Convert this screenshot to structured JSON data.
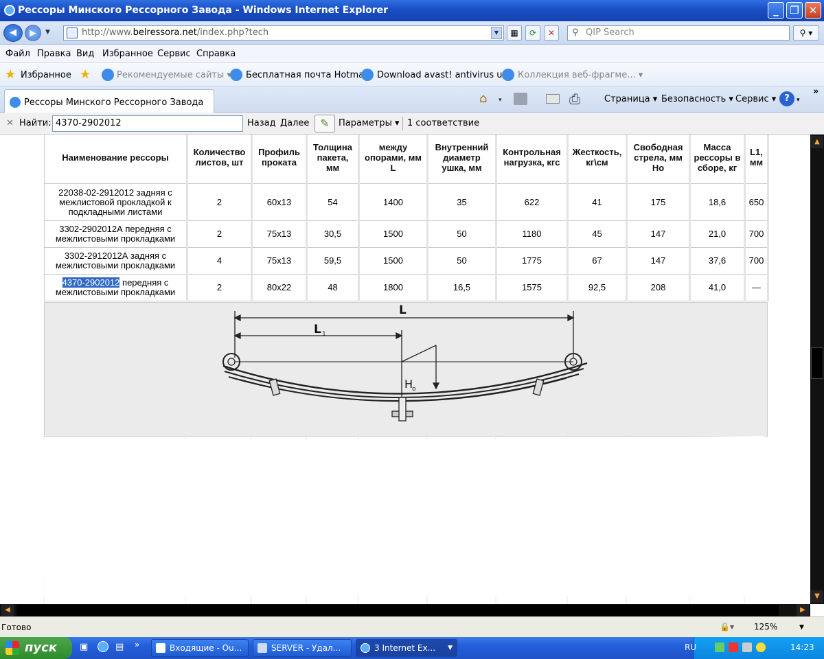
{
  "window": {
    "title": "Рессоры Минского Рессорного Завода - Windows Internet Explorer",
    "min_icon": "minimize-icon",
    "max_icon": "maximize-icon",
    "close_icon": "close-icon"
  },
  "address": {
    "url_prefix": "http://www.",
    "url_domain": "belressora.net",
    "url_suffix": "/index.php?tech",
    "search_placeholder": "QIP Search"
  },
  "menu": [
    "Файл",
    "Правка",
    "Вид",
    "Избранное",
    "Сервис",
    "Справка"
  ],
  "favorites": {
    "label": "Избранное",
    "items": [
      "Рекомендуемые сайты ▾",
      "Бесплатная почта Hotmail",
      "Download avast! antivirus u...",
      "Коллекция веб-фрагме... ▾"
    ]
  },
  "tabs": {
    "active": "Рессоры Минского Рессорного Завода",
    "tools": [
      "Страница ▾",
      "Безопасность ▾",
      "Сервис ▾"
    ]
  },
  "find": {
    "close": "✕",
    "label": "Найти:",
    "value": "4370-2902012",
    "back": "Назад",
    "next": "Далее",
    "options": "Параметры ▾",
    "result": "1 соответствие"
  },
  "table": {
    "headers": [
      "Наименование рессоры",
      "Количество листов, шт",
      "Профиль проката",
      "Толщина пакета, мм",
      "между опорами, мм L",
      "Внутренний диаметр ушка, мм",
      "Контрольная нагрузка, кгс",
      "Жесткость, кг\\см",
      "Свободная стрела, мм Но",
      "Масса рессоры в сборе, кг",
      "L1, мм"
    ],
    "rows": [
      [
        "22038-02-2912012 задняя с межлистовой прокладкой к подкладными листами",
        "2",
        "60x13",
        "54",
        "1400",
        "35",
        "622",
        "41",
        "175",
        "18,6",
        "650"
      ],
      [
        "3302-2902012А передняя с межлистовыми прокладками",
        "2",
        "75x13",
        "30,5",
        "1500",
        "50",
        "1180",
        "45",
        "147",
        "21,0",
        "700"
      ],
      [
        "3302-2912012А задняя с межлистовыми прокладками",
        "4",
        "75x13",
        "59,5",
        "1500",
        "50",
        "1775",
        "67",
        "147",
        "37,6",
        "700"
      ],
      [
        "передняя с межлистовыми прокладками",
        "2",
        "80x22",
        "48",
        "1800",
        "16,5",
        "1575",
        "92,5",
        "208",
        "41,0",
        "—"
      ]
    ],
    "highlight": "4370-2902012"
  },
  "diagram": {
    "label_L": "L",
    "label_L1": "L",
    "label_L1_sub": "1",
    "label_H": "H",
    "label_H_sub": "o"
  },
  "status": {
    "text": "Готово",
    "zoom": "125%"
  },
  "taskbar": {
    "start": "пуск",
    "items": [
      "Входящие - Ou...",
      "SERVER - Удал...",
      "3 Internet Ex..."
    ],
    "lang": "RU",
    "time": "14:23"
  }
}
